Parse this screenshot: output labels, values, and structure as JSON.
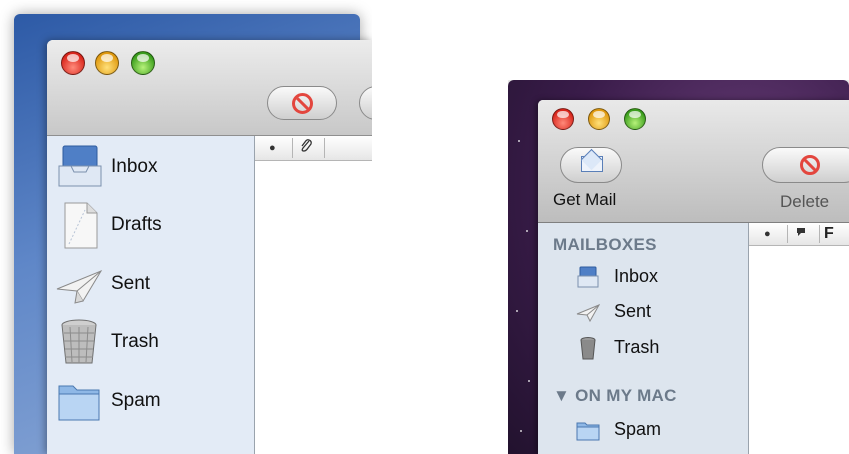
{
  "left_window": {
    "mailboxes": [
      {
        "label": "Inbox",
        "icon": "inbox-icon"
      },
      {
        "label": "Drafts",
        "icon": "drafts-icon"
      },
      {
        "label": "Sent",
        "icon": "sent-icon"
      },
      {
        "label": "Trash",
        "icon": "trash-icon"
      },
      {
        "label": "Spam",
        "icon": "folder-icon"
      }
    ],
    "columns": {
      "unread": "●",
      "attachment": "✎"
    }
  },
  "right_window": {
    "toolbar": {
      "get_mail_label": "Get Mail",
      "delete_label": "Delete"
    },
    "sections": {
      "mailboxes": "MAILBOXES",
      "on_my_mac": "▼ ON MY MAC"
    },
    "mailboxes": [
      {
        "label": "Inbox",
        "icon": "inbox-icon"
      },
      {
        "label": "Sent",
        "icon": "sent-icon"
      },
      {
        "label": "Trash",
        "icon": "trash-icon"
      }
    ],
    "on_my_mac": [
      {
        "label": "Spam",
        "icon": "folder-icon"
      }
    ],
    "columns": {
      "unread": "●",
      "flag": "⚑",
      "from": "F"
    }
  },
  "colors": {
    "left_desktop": "#3d68b4",
    "right_desktop": "#3a1c4a",
    "sidebar_left": "#e3ebf6",
    "sidebar_right": "#dde5ee",
    "section_header": "#6c7a8a",
    "delete_icon": "#e3463e"
  }
}
